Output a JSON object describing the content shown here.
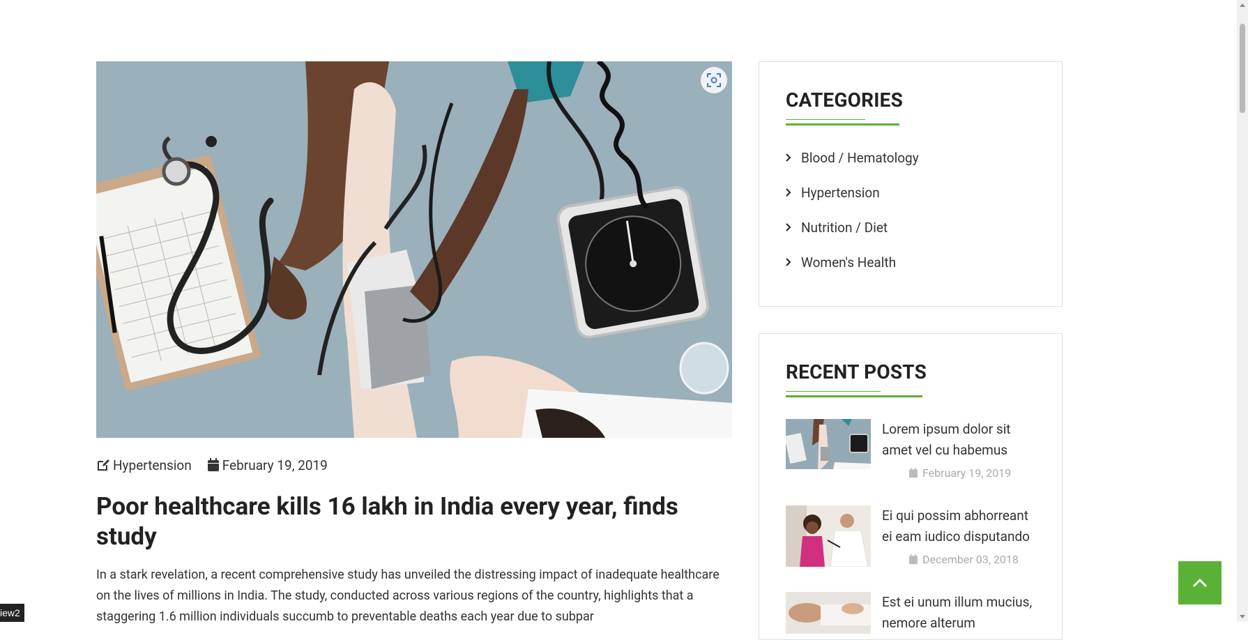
{
  "post": {
    "category": "Hypertension",
    "date": "February 19, 2019",
    "title": "Poor healthcare kills 16 lakh in India every year, finds study",
    "excerpt": "In a stark revelation, a recent comprehensive study has unveiled the distressing impact of inadequate healthcare on the lives of millions in India. The study, conducted across various regions of the country, highlights that a staggering 1.6 million individuals succumb to preventable deaths each year due to subpar"
  },
  "sidebar": {
    "categories": {
      "heading": "CATEGORIES",
      "items": [
        {
          "label": "Blood / Hematology"
        },
        {
          "label": "Hypertension"
        },
        {
          "label": "Nutrition / Diet"
        },
        {
          "label": "Women's Health"
        }
      ]
    },
    "recent_posts": {
      "heading": "RECENT POSTS",
      "items": [
        {
          "title": "Lorem ipsum dolor sit amet vel cu habemus",
          "date": "February 19, 2019"
        },
        {
          "title": "Ei qui possim abhorreant ei eam iudico disputando",
          "date": "December 03, 2018"
        },
        {
          "title": "Est ei unum illum mucius, nemore alterum",
          "date": ""
        }
      ]
    }
  },
  "badge": {
    "text": "iew2"
  },
  "colors": {
    "accent": "#5bb135",
    "text": "#222222",
    "muted": "#aaaaaa",
    "border": "#dedede"
  }
}
